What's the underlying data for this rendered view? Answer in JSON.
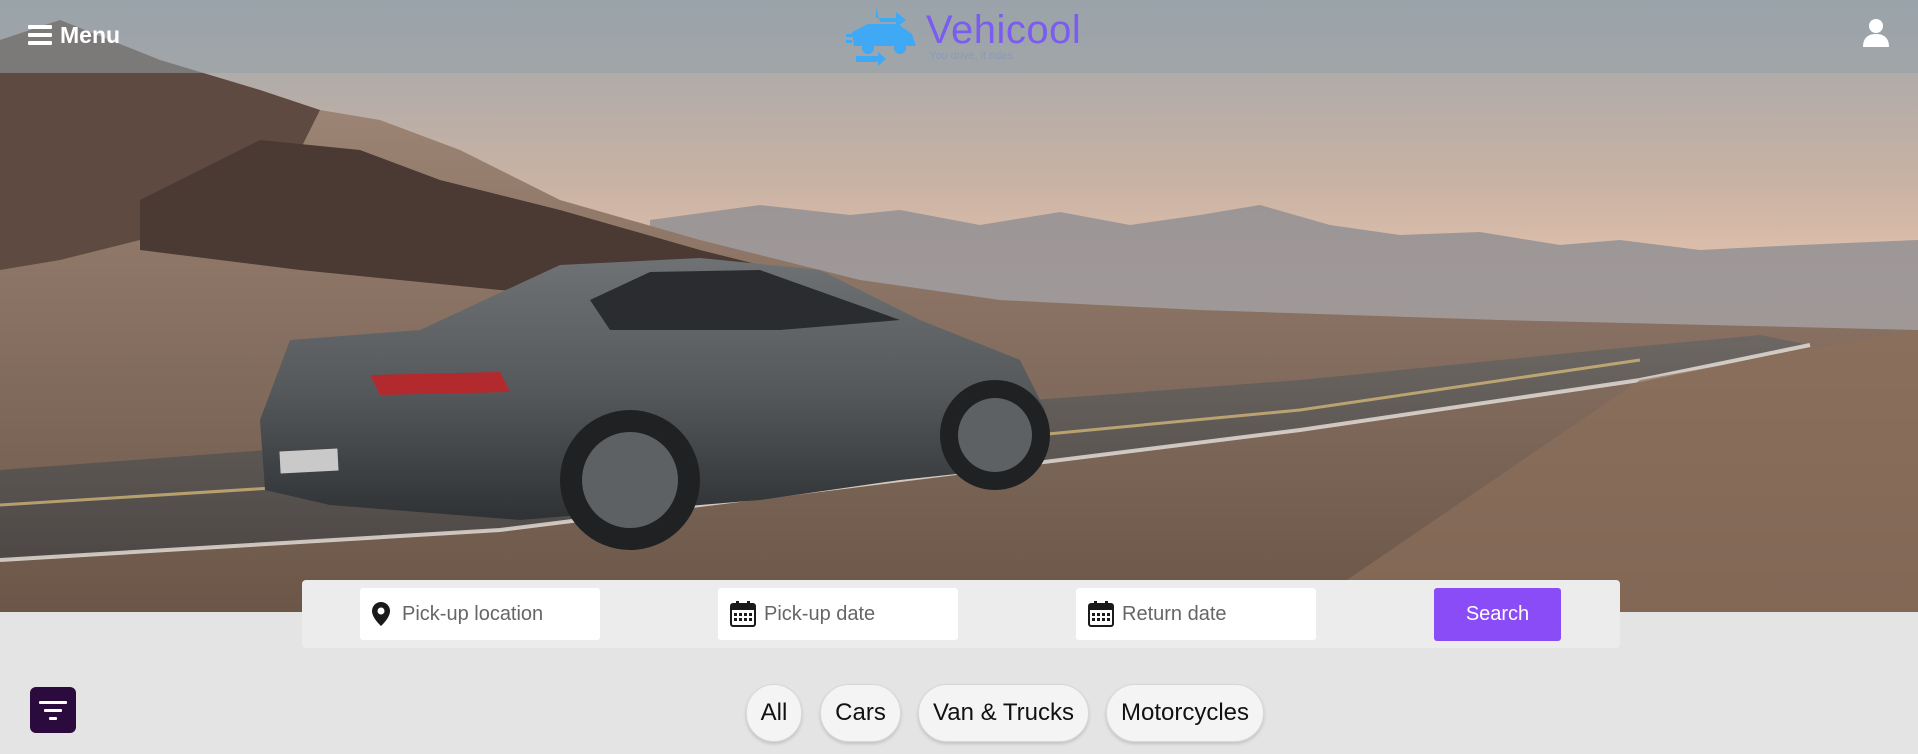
{
  "header": {
    "menu_label": "Menu",
    "brand_name": "Vehicool",
    "tagline": "You drive, it rides"
  },
  "search": {
    "location_placeholder": "Pick-up location",
    "pickup_date_placeholder": "Pick-up date",
    "return_date_placeholder": "Return date",
    "search_label": "Search"
  },
  "categories": [
    {
      "label": "All"
    },
    {
      "label": "Cars"
    },
    {
      "label": "Van & Trucks"
    },
    {
      "label": "Motorcycles"
    }
  ],
  "colors": {
    "accent": "#8a4cf6",
    "filter_button": "#2b0a3d",
    "logo_icon": "#3fa9f5",
    "logo_text": "#7b5cf0"
  },
  "icons": [
    "menu-icon",
    "car-logo-icon",
    "user-icon",
    "location-pin-icon",
    "calendar-icon",
    "filter-icon"
  ]
}
